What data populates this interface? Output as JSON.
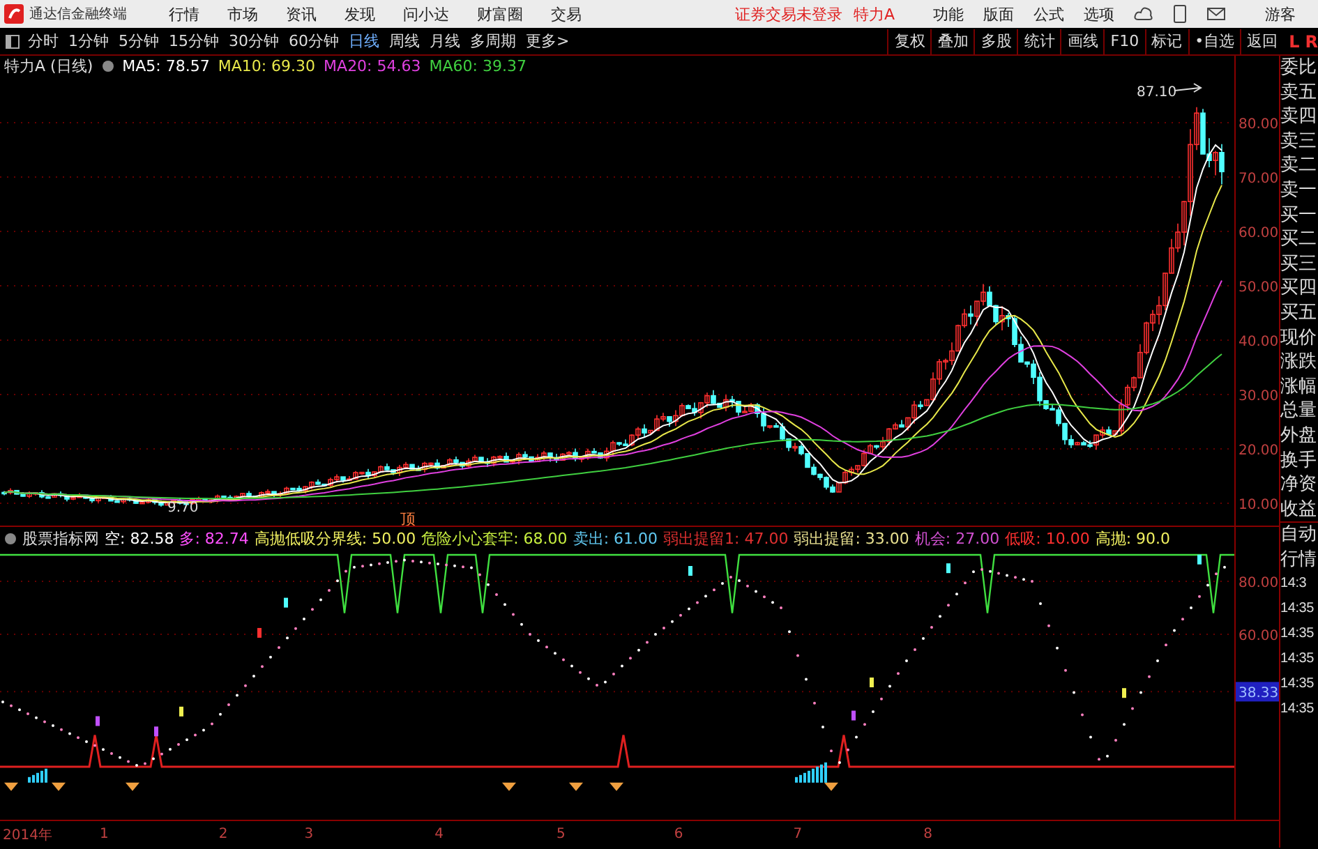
{
  "title_bar": {
    "app_name": "通达信金融终端",
    "menu": [
      "行情",
      "市场",
      "资讯",
      "发现",
      "问小达",
      "财富圈",
      "交易"
    ],
    "login_status": "证券交易未登录",
    "stock_name": "特力A",
    "actions": [
      "功能",
      "版面",
      "公式",
      "选项"
    ],
    "user": "游客"
  },
  "toolbar": {
    "periods": [
      {
        "label": "分时",
        "selected": false
      },
      {
        "label": "1分钟",
        "selected": false
      },
      {
        "label": "5分钟",
        "selected": false
      },
      {
        "label": "15分钟",
        "selected": false
      },
      {
        "label": "30分钟",
        "selected": false
      },
      {
        "label": "60分钟",
        "selected": false
      },
      {
        "label": "日线",
        "selected": true
      },
      {
        "label": "周线",
        "selected": false
      },
      {
        "label": "月线",
        "selected": false
      },
      {
        "label": "多周期",
        "selected": false
      },
      {
        "label": "更多>",
        "selected": false
      }
    ],
    "tools": [
      "复权",
      "叠加",
      "多股",
      "统计",
      "画线",
      "F10",
      "标记",
      "•自选",
      "返回"
    ],
    "badges": [
      "L",
      "R"
    ]
  },
  "main_chart": {
    "title": "特力A (日线)",
    "indicators": [
      {
        "label": "MA5: 78.57",
        "color": "#ffffff"
      },
      {
        "label": "MA10: 69.30",
        "color": "#e8e84a"
      },
      {
        "label": "MA20: 54.63",
        "color": "#e040e0"
      },
      {
        "label": "MA60: 39.37",
        "color": "#40d040"
      }
    ],
    "y_labels": [
      "80.00",
      "70.00",
      "60.00",
      "50.00",
      "40.00",
      "30.00",
      "20.00",
      "10.00"
    ],
    "high_label": "87.10",
    "low_label": "9.70"
  },
  "indicator_chart": {
    "title": "股票指标网",
    "values": [
      {
        "label": "空: 82.58",
        "color": "#ffffff"
      },
      {
        "label": "多: 82.74",
        "color": "#ff50ff"
      },
      {
        "label": "高抛低吸分界线: 50.00",
        "color": "#f0f060"
      },
      {
        "label": "危险小心套牢: 68.00",
        "color": "#c8f040"
      },
      {
        "label": "卖出: 61.00",
        "color": "#60c8f0"
      },
      {
        "label": "弱出提留1: 47.00",
        "color": "#e03030"
      },
      {
        "label": "弱出提留: 33.00",
        "color": "#e8e090"
      },
      {
        "label": "机会: 27.00",
        "color": "#d050d0"
      },
      {
        "label": "低吸: 10.00",
        "color": "#ff3030"
      },
      {
        "label": "高抛: 90.0",
        "color": "#f0f060"
      }
    ],
    "top_marker": "顶",
    "y_labels": [
      "80.00",
      "60.00"
    ],
    "current_value": "38.33"
  },
  "x_axis": [
    "2014年",
    "1",
    "2",
    "3",
    "4",
    "5",
    "6",
    "7",
    "8"
  ],
  "sidebar": {
    "quote_items": [
      "委比",
      "卖五",
      "卖四",
      "卖三",
      "卖二",
      "卖一",
      "买一",
      "买二",
      "买三",
      "买四",
      "买五",
      "现价",
      "涨跌",
      "涨幅",
      "总量",
      "外盘",
      "换手",
      "净资",
      "收益"
    ],
    "bottom_items": [
      "自动",
      "行情"
    ],
    "times": [
      "14:3",
      "14:35",
      "14:35",
      "14:35",
      "14:35",
      "14:35"
    ]
  }
}
